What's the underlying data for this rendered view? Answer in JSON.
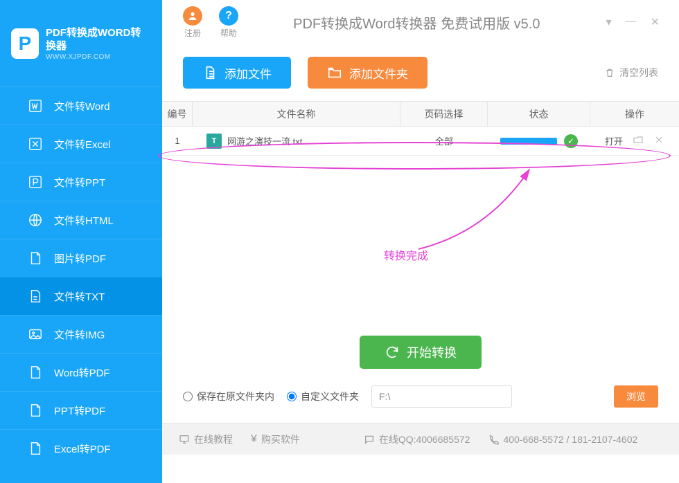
{
  "logo": {
    "mark": "P",
    "title": "PDF转换成WORD转换器",
    "subtitle": "WWW.XJPDF.COM"
  },
  "titlebar": {
    "register": "注册",
    "help": "帮助",
    "title": "PDF转换成Word转换器 免费试用版 v5.0"
  },
  "sidebar": {
    "items": [
      {
        "label": "文件转Word"
      },
      {
        "label": "文件转Excel"
      },
      {
        "label": "文件转PPT"
      },
      {
        "label": "文件转HTML"
      },
      {
        "label": "图片转PDF"
      },
      {
        "label": "文件转TXT"
      },
      {
        "label": "文件转IMG"
      },
      {
        "label": "Word转PDF"
      },
      {
        "label": "PPT转PDF"
      },
      {
        "label": "Excel转PDF"
      }
    ]
  },
  "toolbar": {
    "add_file": "添加文件",
    "add_folder": "添加文件夹",
    "clear_list": "清空列表"
  },
  "table": {
    "headers": {
      "num": "编号",
      "name": "文件名称",
      "page": "页码选择",
      "status": "状态",
      "op": "操作"
    },
    "rows": [
      {
        "num": "1",
        "name": "网游之演技一流.txt",
        "page": "全部",
        "open": "打开"
      }
    ]
  },
  "annotation": {
    "text": "转换完成"
  },
  "actions": {
    "start": "开始转换"
  },
  "save": {
    "opt_same": "保存在原文件夹内",
    "opt_custom": "自定义文件夹",
    "path": "F:\\",
    "browse": "浏览"
  },
  "footer": {
    "tutorial": "在线教程",
    "buy": "购买软件",
    "qq_label": "在线QQ:4006685572",
    "phone": "400-668-5572 / 181-2107-4602"
  },
  "colors": {
    "primary": "#19a6f8",
    "orange": "#f78a3c",
    "green": "#4bb64e",
    "magenta": "#e443d4"
  }
}
